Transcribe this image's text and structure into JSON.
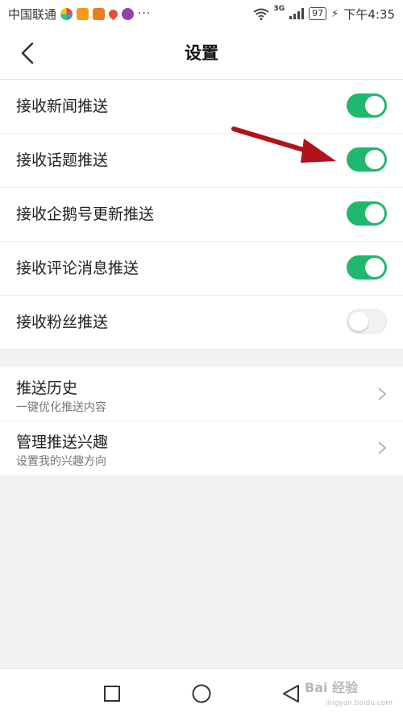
{
  "status_bar": {
    "carrier": "中国联通",
    "network": "3G",
    "battery": "97",
    "time": "下午4:35",
    "more": "···"
  },
  "header": {
    "title": "设置"
  },
  "push_settings": {
    "items": [
      {
        "label": "接收新闻推送",
        "enabled": true
      },
      {
        "label": "接收话题推送",
        "enabled": true
      },
      {
        "label": "接收企鹅号更新推送",
        "enabled": true
      },
      {
        "label": "接收评论消息推送",
        "enabled": true
      },
      {
        "label": "接收粉丝推送",
        "enabled": false
      }
    ]
  },
  "push_management": {
    "items": [
      {
        "title": "推送历史",
        "subtitle": "一键优化推送内容"
      },
      {
        "title": "管理推送兴趣",
        "subtitle": "设置我的兴趣方向"
      }
    ]
  },
  "watermark": {
    "text": "Bai 经验",
    "sub": "jingyan.baidu.com"
  },
  "colors": {
    "toggle_on": "#1fb86e",
    "toggle_off": "#f1f1f1",
    "annotation_arrow": "#b3121b"
  }
}
